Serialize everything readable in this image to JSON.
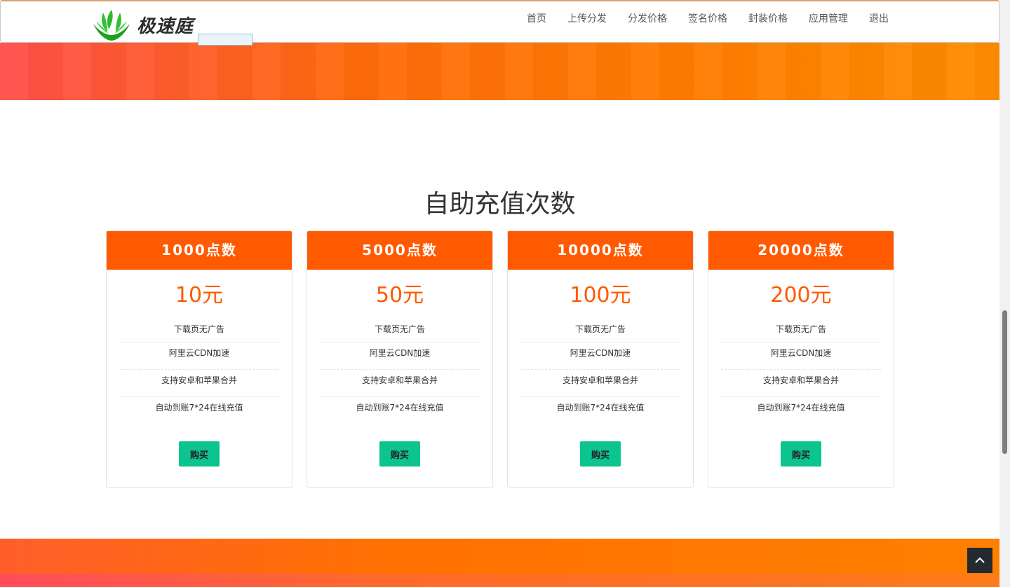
{
  "header": {
    "logo_text": "极速庭",
    "nav": [
      {
        "label": "首页"
      },
      {
        "label": "上传分发"
      },
      {
        "label": "分发价格"
      },
      {
        "label": "签名价格"
      },
      {
        "label": "封装价格"
      },
      {
        "label": "应用管理"
      },
      {
        "label": "退出"
      }
    ]
  },
  "section": {
    "title": "自助充值次数"
  },
  "plans": [
    {
      "name": "1000点数",
      "price": "10元",
      "features": [
        "下载页无广告",
        "阿里云CDN加速",
        "支持安卓和苹果合并",
        "自动到账7*24在线充值"
      ],
      "button": "购买"
    },
    {
      "name": "5000点数",
      "price": "50元",
      "features": [
        "下载页无广告",
        "阿里云CDN加速",
        "支持安卓和苹果合并",
        "自动到账7*24在线充值"
      ],
      "button": "购买"
    },
    {
      "name": "10000点数",
      "price": "100元",
      "features": [
        "下载页无广告",
        "阿里云CDN加速",
        "支持安卓和苹果合并",
        "自动到账7*24在线充值"
      ],
      "button": "购买"
    },
    {
      "name": "20000点数",
      "price": "200元",
      "features": [
        "下载页无广告",
        "阿里云CDN加速",
        "支持安卓和苹果合并",
        "自动到账7*24在线充值"
      ],
      "button": "购买"
    }
  ],
  "colors": {
    "accent": "#ff5a00",
    "button": "#0cc48f",
    "logo_green": "#2eb82e"
  },
  "icons": {
    "logo": "leaf-hands-icon",
    "back_to_top": "chevron-up-icon"
  }
}
